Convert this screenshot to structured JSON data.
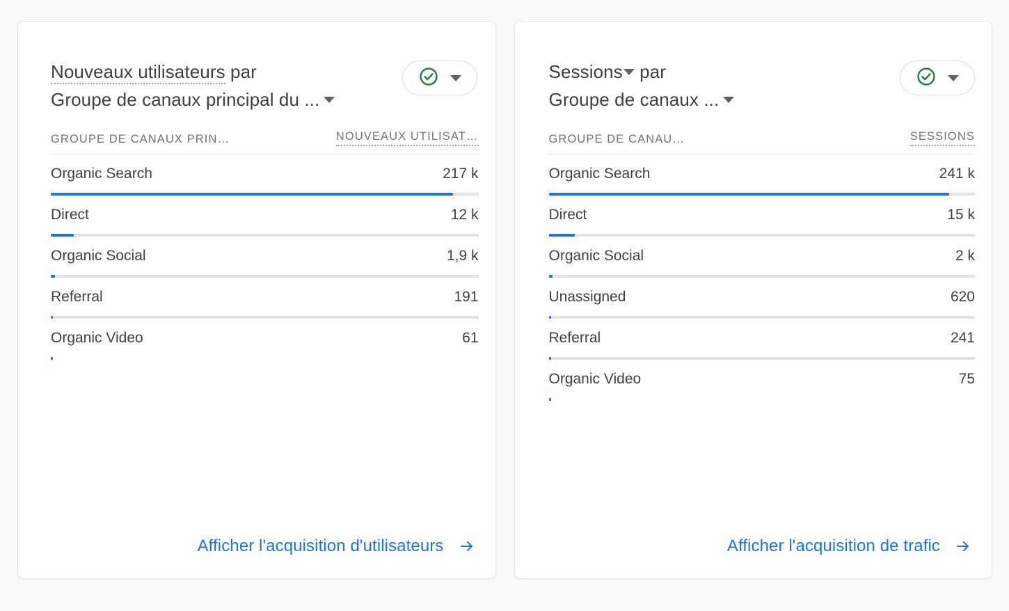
{
  "theme": {
    "page_background": "#f8f9fa",
    "card_background": "#ffffff",
    "bar_color": "#1a73e8",
    "bar_track_color": "#e0e2e4",
    "link_color": "#1a73e8",
    "check_color": "#188038",
    "text_color": "#3c4043",
    "header_text_color": "#6e7479"
  },
  "cards": [
    {
      "title": {
        "metric_label": "Nouveaux utilisateurs",
        "connector": " par",
        "dimension_label": "Groupe de canaux principal du ..."
      },
      "comparison_button": {
        "icon": "check-circle-icon",
        "caret": "chevron-down-icon"
      },
      "table": {
        "columns": {
          "dimension": "GROUPE DE CANAUX PRIN…",
          "metric": "NOUVEAUX UTILISAT…"
        },
        "rows": [
          {
            "label": "Organic Search",
            "value": "217 k",
            "bar_percent": 94
          },
          {
            "label": "Direct",
            "value": "12 k",
            "bar_percent": 5.4
          },
          {
            "label": "Organic Social",
            "value": "1,9 k",
            "bar_percent": 0.9
          },
          {
            "label": "Referral",
            "value": "191",
            "bar_percent": 0.4
          },
          {
            "label": "Organic Video",
            "value": "61",
            "bar_percent": 0.3
          }
        ]
      },
      "footer_link": {
        "label": "Afficher l'acquisition d'utilisateurs",
        "icon": "arrow-right-icon"
      }
    },
    {
      "title": {
        "metric_label": "Sessions",
        "connector": " par",
        "dimension_label": "Groupe de canaux ..."
      },
      "comparison_button": {
        "icon": "check-circle-icon",
        "caret": "chevron-down-icon"
      },
      "table": {
        "columns": {
          "dimension": "GROUPE DE CANAU…",
          "metric": "SESSIONS"
        },
        "rows": [
          {
            "label": "Organic Search",
            "value": "241 k",
            "bar_percent": 94
          },
          {
            "label": "Direct",
            "value": "15 k",
            "bar_percent": 6.2
          },
          {
            "label": "Organic Social",
            "value": "2 k",
            "bar_percent": 0.9
          },
          {
            "label": "Unassigned",
            "value": "620",
            "bar_percent": 0.4
          },
          {
            "label": "Referral",
            "value": "241",
            "bar_percent": 0.35
          },
          {
            "label": "Organic Video",
            "value": "75",
            "bar_percent": 0.3
          }
        ]
      },
      "footer_link": {
        "label": "Afficher l'acquisition de trafic",
        "icon": "arrow-right-icon"
      }
    }
  ],
  "chart_data": {
    "type": "bar",
    "title": "Acquisition par groupe de canaux principal",
    "charts": [
      {
        "title": "Nouveaux utilisateurs par Groupe de canaux principal du ...",
        "xlabel": "GROUPE DE CANAUX PRIN…",
        "ylabel": "NOUVEAUX UTILISAT…",
        "categories": [
          "Organic Search",
          "Direct",
          "Organic Social",
          "Referral",
          "Organic Video"
        ],
        "value_labels": [
          "217 k",
          "12 k",
          "1,9 k",
          "191",
          "61"
        ],
        "values": [
          217000,
          12000,
          1900,
          191,
          61
        ],
        "orientation": "horizontal",
        "grid": false,
        "legend": "none"
      },
      {
        "title": "Sessions par Groupe de canaux ...",
        "xlabel": "GROUPE DE CANAU…",
        "ylabel": "SESSIONS",
        "categories": [
          "Organic Search",
          "Direct",
          "Organic Social",
          "Unassigned",
          "Referral",
          "Organic Video"
        ],
        "value_labels": [
          "241 k",
          "15 k",
          "2 k",
          "620",
          "241",
          "75"
        ],
        "values": [
          241000,
          15000,
          2000,
          620,
          241,
          75
        ],
        "orientation": "horizontal",
        "grid": false,
        "legend": "none"
      }
    ]
  }
}
